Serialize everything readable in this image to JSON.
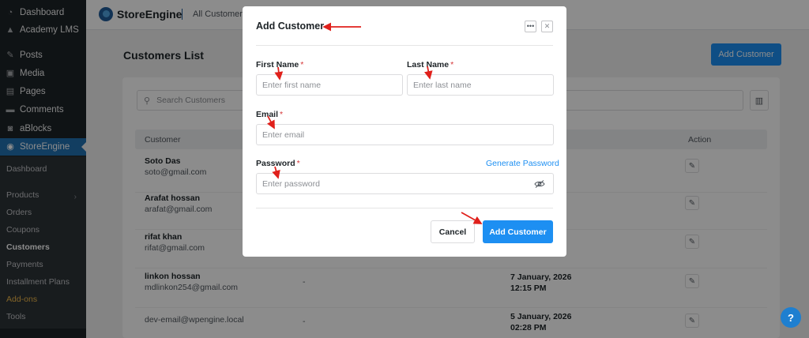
{
  "sidebar": {
    "top_items": [
      {
        "label": "Dashboard",
        "icon": "dashboard-icon"
      },
      {
        "label": "Academy LMS",
        "icon": "graduation-icon"
      },
      {
        "label": "Posts",
        "icon": "pin-icon"
      },
      {
        "label": "Media",
        "icon": "media-icon"
      },
      {
        "label": "Pages",
        "icon": "pages-icon"
      },
      {
        "label": "Comments",
        "icon": "comments-icon"
      },
      {
        "label": "aBlocks",
        "icon": "ablocks-icon"
      },
      {
        "label": "StoreEngine",
        "icon": "storeengine-icon"
      }
    ],
    "sub_items": [
      {
        "label": "Dashboard"
      },
      {
        "label": "Products"
      },
      {
        "label": "Orders"
      },
      {
        "label": "Coupons"
      },
      {
        "label": "Customers"
      },
      {
        "label": "Payments"
      },
      {
        "label": "Installment Plans"
      },
      {
        "label": "Add-ons"
      },
      {
        "label": "Tools"
      }
    ]
  },
  "topbar": {
    "brand": "StoreEngine",
    "breadcrumb": "All Customers"
  },
  "page": {
    "title": "Customers List",
    "add_button": "Add Customer",
    "search_placeholder": "Search Customers",
    "columns": {
      "customer": "Customer",
      "action": "Action"
    },
    "rows": [
      {
        "name": "Soto Das",
        "email": "soto@gmail.com",
        "dash": "",
        "date": "",
        "time": ""
      },
      {
        "name": "Arafat hossan",
        "email": "arafat@gmail.com",
        "dash": "",
        "date": "",
        "time": ""
      },
      {
        "name": "rifat khan",
        "email": "rifat@gmail.com",
        "dash": "",
        "date": "",
        "time": ""
      },
      {
        "name": "linkon hossan",
        "email": "mdlinkon254@gmail.com",
        "dash": "-",
        "date": "7 January, 2026",
        "time": "12:15 PM"
      },
      {
        "name": "",
        "email": "dev-email@wpengine.local",
        "dash": "-",
        "date": "5 January, 2026",
        "time": "02:28 PM"
      }
    ]
  },
  "modal": {
    "title": "Add Customer",
    "first_name": {
      "label": "First Name",
      "placeholder": "Enter first name"
    },
    "last_name": {
      "label": "Last Name",
      "placeholder": "Enter last name"
    },
    "email": {
      "label": "Email",
      "placeholder": "Enter email"
    },
    "password": {
      "label": "Password",
      "placeholder": "Enter password"
    },
    "required_mark": "*",
    "generate_password": "Generate Password",
    "cancel": "Cancel",
    "submit": "Add Customer"
  },
  "help_button": "?",
  "colors": {
    "sidebar_bg": "#1d2327",
    "submenu_bg": "#2c3338",
    "active_bg": "#2271b1",
    "primary_button": "#1d8ff2",
    "annotation_arrow": "#e0201b",
    "required": "#d63638"
  }
}
